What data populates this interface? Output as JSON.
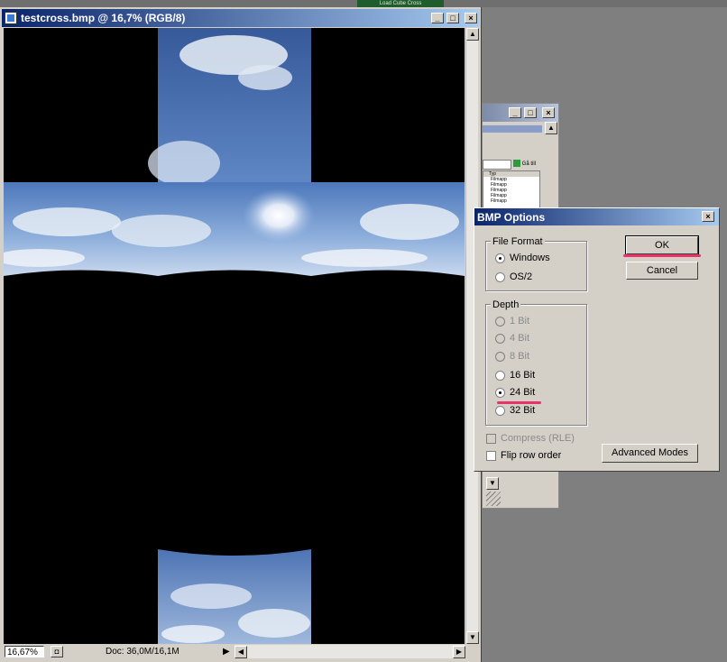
{
  "document_window": {
    "title": "testcross.bmp @ 16,7% (RGB/8)",
    "zoom": "16,67%",
    "doc_info": "Doc: 36,0M/16,1M"
  },
  "background_window": {
    "button_label": "Gå till",
    "column_header": "Typ",
    "file_rows": [
      "Filmapp",
      "Filmapp",
      "Filmapp",
      "Filmapp",
      "Filmapp"
    ]
  },
  "top_strip_label": "Load Cube Cross",
  "dialog": {
    "title": "BMP Options",
    "file_format": {
      "label": "File Format",
      "options": [
        {
          "label": "Windows",
          "selected": true
        },
        {
          "label": "OS/2",
          "selected": false
        }
      ]
    },
    "depth": {
      "label": "Depth",
      "options": [
        {
          "label": "1 Bit",
          "enabled": false,
          "selected": false
        },
        {
          "label": "4 Bit",
          "enabled": false,
          "selected": false
        },
        {
          "label": "8 Bit",
          "enabled": false,
          "selected": false
        },
        {
          "label": "16 Bit",
          "enabled": true,
          "selected": false
        },
        {
          "label": "24 Bit",
          "enabled": true,
          "selected": true
        },
        {
          "label": "32 Bit",
          "enabled": true,
          "selected": false
        }
      ]
    },
    "compress_label": "Compress (RLE)",
    "flip_label": "Flip row order",
    "ok_label": "OK",
    "cancel_label": "Cancel",
    "advanced_label": "Advanced Modes"
  },
  "colors": {
    "titlebar_start": "#0a246a",
    "titlebar_end": "#a6caf0",
    "highlight_mark": "#e8326a",
    "sky": "#4f78b6"
  }
}
